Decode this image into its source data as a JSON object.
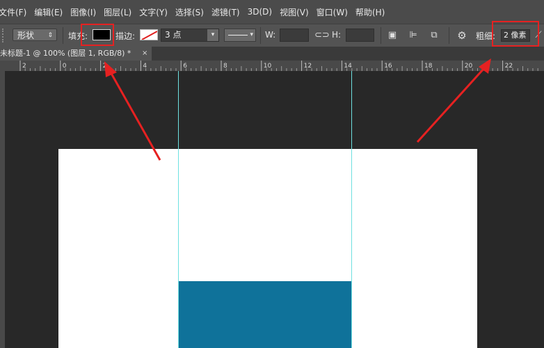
{
  "menu": [
    "文件(F)",
    "编辑(E)",
    "图像(I)",
    "图层(L)",
    "文字(Y)",
    "选择(S)",
    "滤镜(T)",
    "3D(D)",
    "视图(V)",
    "窗口(W)",
    "帮助(H)"
  ],
  "options": {
    "mode": "形状",
    "fill_label": "填充:",
    "stroke_label": "描边:",
    "stroke_size": "3 点",
    "w_label": "W:",
    "h_label": "H:",
    "weight_label": "粗细:",
    "weight_value": "2 像素"
  },
  "document": {
    "tab_title": "未标题-1 @ 100% (图层 1, RGB/8) *",
    "close": "×"
  },
  "ruler_labels": [
    "2",
    "0",
    "2",
    "4",
    "6",
    "8",
    "10",
    "12",
    "14",
    "16",
    "18",
    "20",
    "22"
  ],
  "colors": {
    "fill": "#000000",
    "shape": "#0f729a",
    "guide": "#6ee0e0",
    "highlight": "#e62121"
  },
  "icons": {
    "link": "chain-link-icon",
    "gear": "gear-icon"
  }
}
